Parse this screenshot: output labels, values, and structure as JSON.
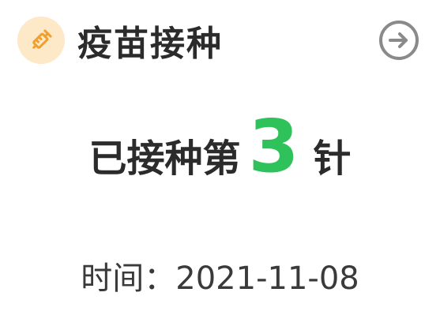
{
  "header": {
    "icon": "syringe-icon",
    "title": "疫苗接种",
    "action_icon": "arrow-right-circle-icon"
  },
  "dose": {
    "prefix": "已接种第",
    "number": "3",
    "suffix": "针"
  },
  "time": {
    "label": "时间：",
    "value": "2021-11-08"
  },
  "colors": {
    "accent_green": "#2fc25b",
    "icon_orange": "#f0a030",
    "icon_bg": "#fde8c8",
    "text_dark": "#2b2b2b",
    "arrow_gray": "#8a8a8a"
  }
}
